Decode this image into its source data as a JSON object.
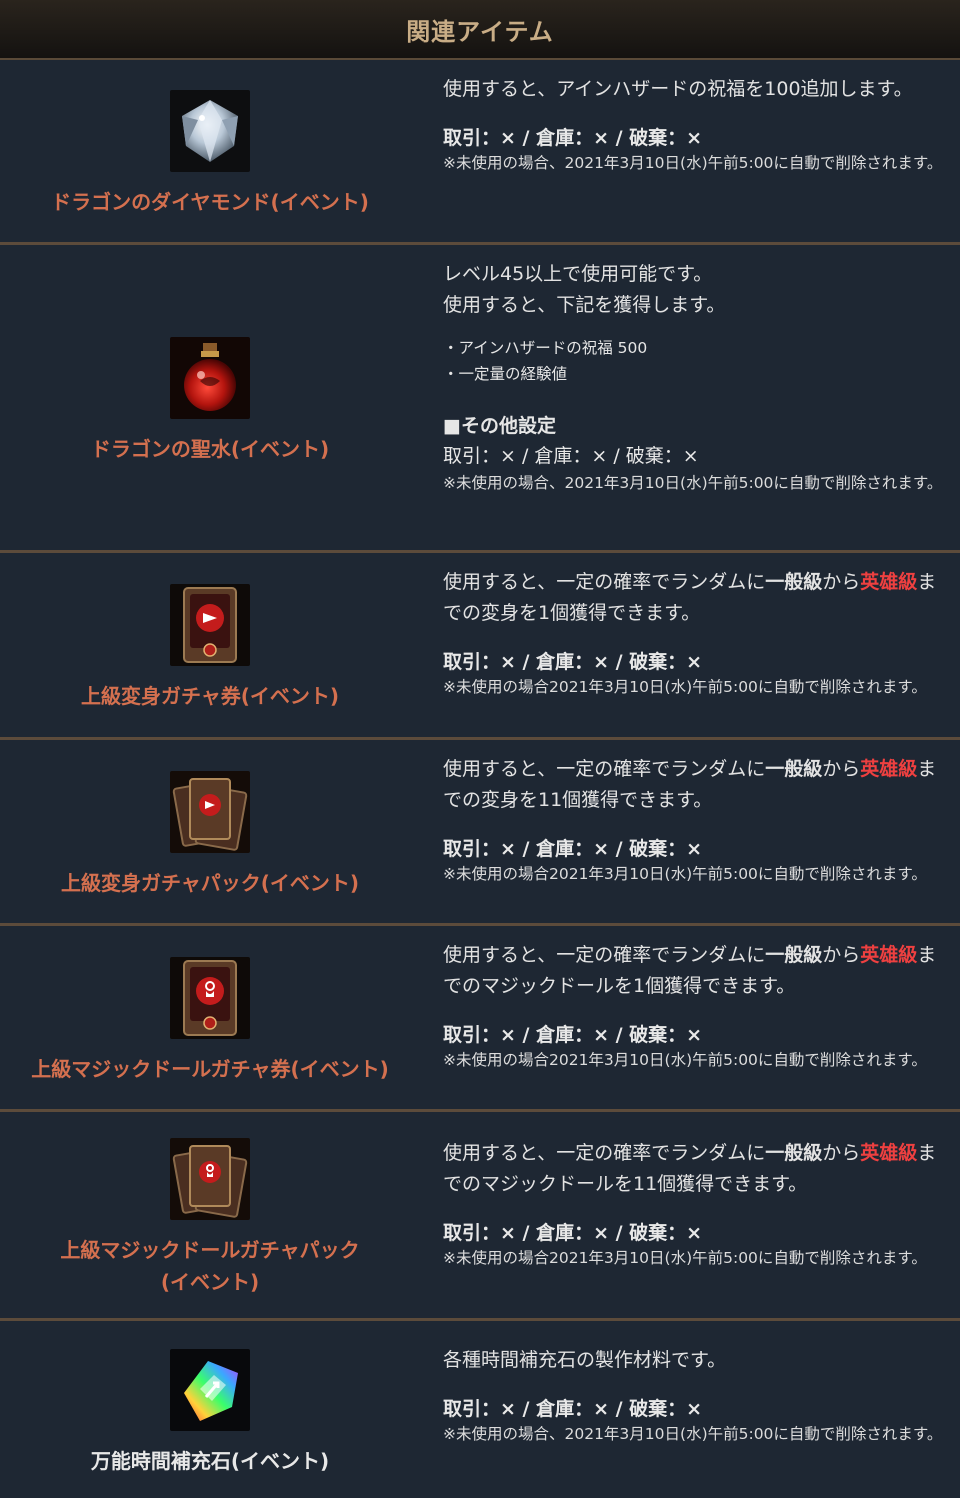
{
  "header": {
    "title": "関連アイテム"
  },
  "items": [
    {
      "name": "ドラゴンのダイヤモンド(イベント)",
      "icon": "diamond-icon",
      "desc": "使用すると、アインハザードの祝福を100追加します。",
      "trade": "取引：× / 倉庫：× / 破棄：×",
      "note": "※未使用の場合、2021年3月10日(水)午前5:00に自動で削除されます。"
    },
    {
      "name": "ドラゴンの聖水(イベント)",
      "icon": "holy-water-potion-icon",
      "desc_lines": [
        "レベル45以上で使用可能です。",
        "使用すると、下記を獲得します。"
      ],
      "bullets": [
        "・アインハザードの祝福 500",
        "・一定量の経験値"
      ],
      "section_title": "■その他設定",
      "trade": "取引：× / 倉庫：× / 破棄：×",
      "note": "※未使用の場合、2021年3月10日(水)午前5:00に自動で削除されます。"
    },
    {
      "name": "上級変身ガチャ券(イベント)",
      "icon": "transform-ticket-icon",
      "desc_pre": "使用すると、一定の確率でランダムに",
      "desc_bold": "一般級",
      "desc_mid": "から",
      "desc_red": "英雄級",
      "desc_post": "までの変身を1個獲得できます。",
      "trade": "取引：× / 倉庫：× / 破棄：×",
      "note": "※未使用の場合2021年3月10日(水)午前5:00に自動で削除されます。"
    },
    {
      "name": "上級変身ガチャパック(イベント)",
      "icon": "transform-pack-icon",
      "desc_pre": "使用すると、一定の確率でランダムに",
      "desc_bold": "一般級",
      "desc_mid": "から",
      "desc_red": "英雄級",
      "desc_post": "までの変身を11個獲得できます。",
      "trade": "取引：× / 倉庫：× / 破棄：×",
      "note": "※未使用の場合2021年3月10日(水)午前5:00に自動で削除されます。"
    },
    {
      "name": "上級マジックドールガチャ券(イベント)",
      "icon": "magic-doll-ticket-icon",
      "desc_pre": "使用すると、一定の確率でランダムに",
      "desc_bold": "一般級",
      "desc_mid": "から",
      "desc_red": "英雄級",
      "desc_post": "までのマジックドールを1個獲得できます。",
      "trade": "取引：× / 倉庫：× / 破棄：×",
      "note": "※未使用の場合2021年3月10日(水)午前5:00に自動で削除されます。"
    },
    {
      "name_line1": "上級マジックドールガチャパック",
      "name_line2": "(イベント)",
      "icon": "magic-doll-pack-icon",
      "desc_pre": "使用すると、一定の確率でランダムに",
      "desc_bold": "一般級",
      "desc_mid": "から",
      "desc_red": "英雄級",
      "desc_post": "までのマジックドールを11個獲得できます。",
      "trade": "取引：× / 倉庫：× / 破棄：×",
      "note": "※未使用の場合2021年3月10日(水)午前5:00に自動で削除されます。"
    },
    {
      "name": "万能時間補充石(イベント)",
      "icon": "rainbow-crystal-icon",
      "desc": "各種時間補充石の製作材料です。",
      "trade": "取引：× / 倉庫：× / 破棄：×",
      "note": "※未使用の場合、2021年3月10日(水)午前5:00に自動で削除されます。"
    }
  ],
  "colors": {
    "accent_red": "#ee4040",
    "item_name": "#d4704f",
    "header_text": "#c9ad86",
    "background": "#1e2733",
    "divider": "#5c4b3b"
  }
}
